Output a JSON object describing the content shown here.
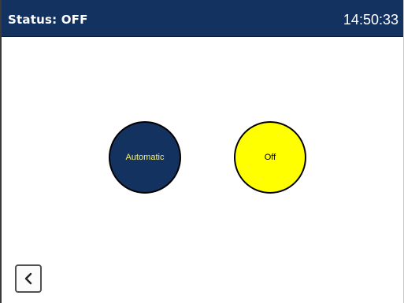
{
  "header": {
    "status": "Status: OFF",
    "time": "14:50:33"
  },
  "modes": {
    "automatic_label": "Automatic",
    "off_label": "Off"
  },
  "navigation": {
    "back_icon": "chevron-left-icon"
  },
  "colors": {
    "header_bg": "#143260",
    "automatic_bg": "#143260",
    "automatic_text": "#f3f07a",
    "off_bg": "#ffff00"
  }
}
